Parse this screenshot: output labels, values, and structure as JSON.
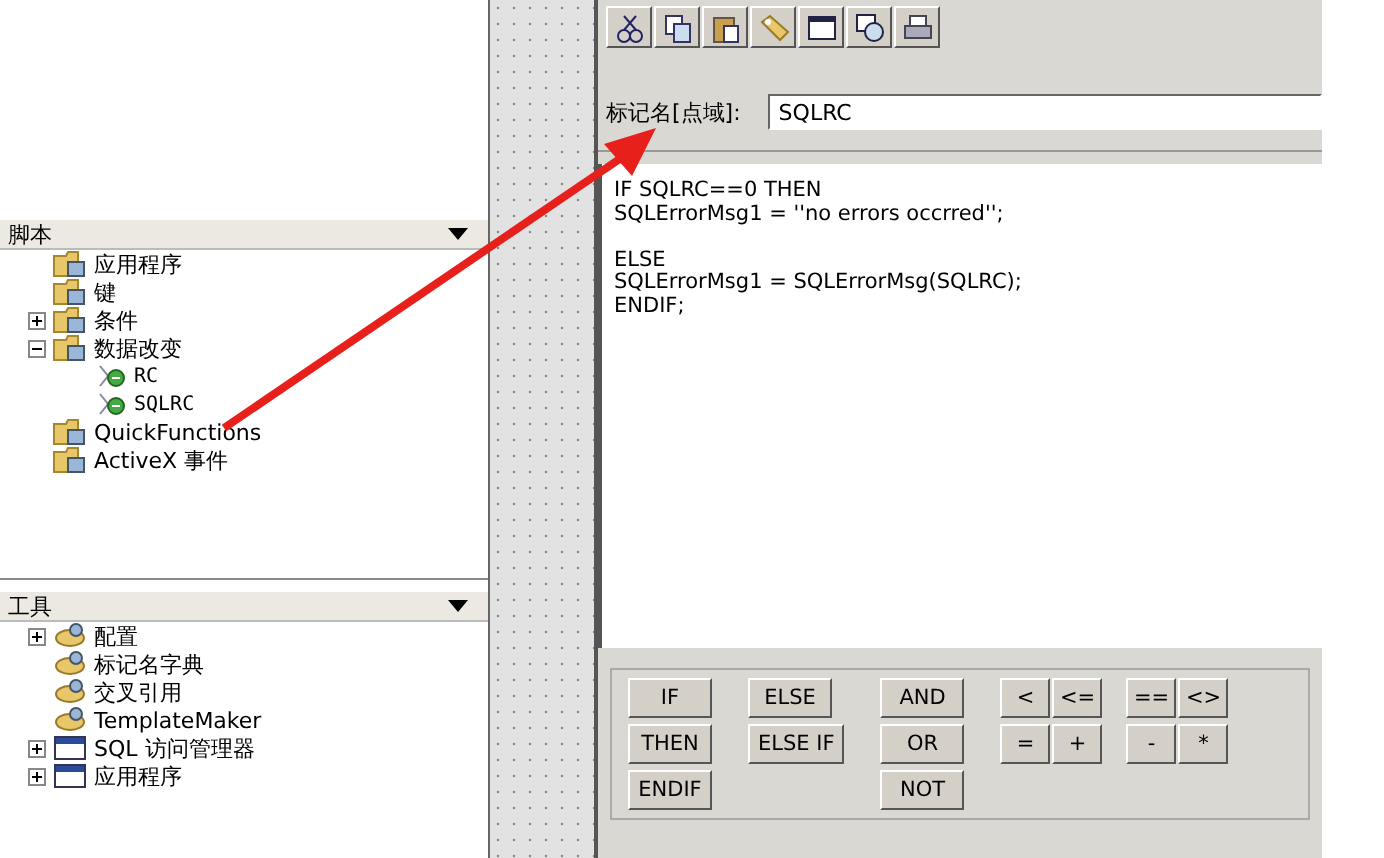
{
  "script_panel": {
    "title": "脚本",
    "tree": [
      {
        "label": "应用程序",
        "kind": "folder"
      },
      {
        "label": "键",
        "kind": "folder"
      },
      {
        "label": "条件",
        "kind": "folder",
        "expanded": false
      },
      {
        "label": "数据改变",
        "kind": "folder",
        "expanded": true,
        "children": [
          {
            "label": "RC",
            "kind": "action"
          },
          {
            "label": "SQLRC",
            "kind": "action"
          }
        ]
      },
      {
        "label": "QuickFunctions",
        "kind": "folder"
      },
      {
        "label": "ActiveX 事件",
        "kind": "folder"
      }
    ]
  },
  "tools_panel": {
    "title": "工具",
    "tree": [
      {
        "label": "配置",
        "kind": "tool",
        "expanded": false
      },
      {
        "label": "标记名字典",
        "kind": "tool"
      },
      {
        "label": "交叉引用",
        "kind": "tool"
      },
      {
        "label": "TemplateMaker",
        "kind": "tool"
      },
      {
        "label": "SQL 访问管理器",
        "kind": "window",
        "expanded": false
      },
      {
        "label": "应用程序",
        "kind": "window",
        "expanded": false
      }
    ]
  },
  "editor": {
    "tag_label": "标记名[点域]:",
    "tag_value": "SQLRC",
    "code_blocks": [
      [
        "IF SQLRC==0 THEN",
        "SQLErrorMsg1 = ''no errors occrred'';"
      ],
      [
        "ELSE",
        "SQLErrorMsg1 = SQLErrorMsg(SQLRC);",
        "ENDIF;"
      ]
    ]
  },
  "button_columns": [
    [
      [
        "IF"
      ],
      [
        "THEN"
      ],
      [
        "ENDIF"
      ]
    ],
    [
      [
        "ELSE"
      ],
      [
        "ELSE IF"
      ]
    ],
    [
      [
        "AND"
      ],
      [
        "OR"
      ],
      [
        "NOT"
      ]
    ],
    [
      [
        "<",
        "<="
      ],
      [
        "=",
        "+"
      ]
    ],
    [
      [
        "==",
        "<>"
      ],
      [
        "-",
        "*"
      ]
    ]
  ]
}
